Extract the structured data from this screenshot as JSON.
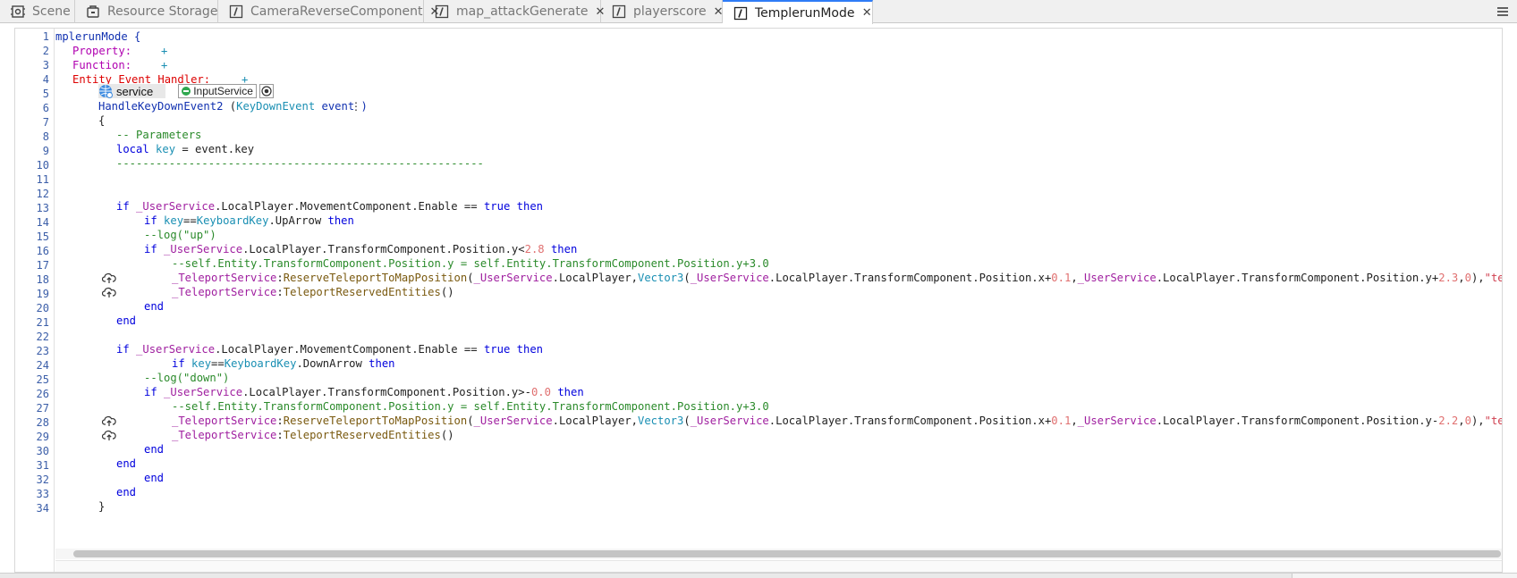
{
  "tabs": [
    {
      "label": "Scene",
      "icon": "scene-icon",
      "closable": false,
      "active": false
    },
    {
      "label": "Resource Storage",
      "icon": "storage-icon",
      "closable": false,
      "active": false
    },
    {
      "label": "CameraReverseComponent",
      "icon": "script-icon",
      "closable": true,
      "active": false
    },
    {
      "label": "map_attackGenerate",
      "icon": "script-icon",
      "closable": true,
      "active": false
    },
    {
      "label": "playerscore",
      "icon": "script-icon",
      "closable": true,
      "active": false
    },
    {
      "label": "TemplerunMode",
      "icon": "script-icon",
      "closable": true,
      "active": true
    }
  ],
  "menu_icon": "hamburger-menu-icon",
  "line_numbers": [
    "1",
    "2",
    "3",
    "4",
    "5",
    "6",
    "7",
    "8",
    "9",
    "10",
    "11",
    "12",
    "13",
    "14",
    "15",
    "16",
    "17",
    "18",
    "19",
    "20",
    "21",
    "22",
    "23",
    "24",
    "25",
    "26",
    "27",
    "28",
    "29",
    "30",
    "31",
    "32",
    "33",
    "34"
  ],
  "code": {
    "l1": "mplerunMode {",
    "l2_kw": "Property:",
    "l2_plus": "+",
    "l3_kw": "Function:",
    "l3_plus": "+",
    "l4_kw": "Entity Event Handler:",
    "l4_plus": "+",
    "service_label": "service",
    "service_type": "InputService",
    "l6_fn": "HandleKeyDownEvent2",
    "l6_open": " (",
    "l6_type": "KeyDownEvent",
    "l6_param": " event )",
    "l6_more": "⋮",
    "l7": "{",
    "l8": "-- Parameters",
    "l9_local": "local",
    "l9_key": "key",
    "l9_rest": " = event.key",
    "l10": "--------------------------------------------------------",
    "if": "if",
    "then": "then",
    "true": "true",
    "end": "end",
    "userservice": "_UserService",
    "teleportservice": "_TeleportService",
    "keyboardkey": "KeyboardKey",
    "movement_enable": ".LocalPlayer.MovementComponent.Enable == ",
    "l14_key": "key",
    "l14_eq": "==",
    "l14_rest": ".UpArrow ",
    "l15": "--log(\"up\")",
    "l16_mid": ".LocalPlayer.TransformComponent.Position.y<",
    "l16_num": "2.8",
    "l17": "--self.Entity.TransformComponent.Position.y = self.Entity.TransformComponent.Position.y+3.0",
    "reserve_fn": "ReserveTeleportToMapPosition",
    "localplayer_comma": ".LocalPlayer,",
    "vector3": "Vector3",
    "pos_x_plus": ".LocalPlayer.TransformComponent.Position.x+",
    "num_0_1": "0.1",
    "pos_y_plus": ".LocalPlayer.TransformComponent.Position.y+",
    "num_2_3": "2.3",
    "num_0": "0",
    "str_templerun": "\"templerun\"",
    "teleport_fn": "TeleportReservedEntities",
    "l24_rest": ".DownArrow ",
    "l25": "--log(\"down\")",
    "l26_mid": ".LocalPlayer.TransformComponent.Position.y>-",
    "l26_num": "0.0",
    "l27": "--self.Entity.TransformComponent.Position.y = self.Entity.TransformComponent.Position.y+3.0",
    "pos_y_minus": ".LocalPlayer.TransformComponent.Position.y-",
    "num_2_2": "2.2",
    "l34": "}"
  },
  "colors": {
    "accent_tab": "#2f7cf6",
    "keyword": "#0000dd",
    "type": "#1a8fb3",
    "service": "#a020a0",
    "function": "#7a5a10",
    "comment": "#2a8a2a",
    "number": "#e07070",
    "string": "#d04050",
    "event_handler_header": "#dd0000",
    "section_header": "#b000b0"
  }
}
